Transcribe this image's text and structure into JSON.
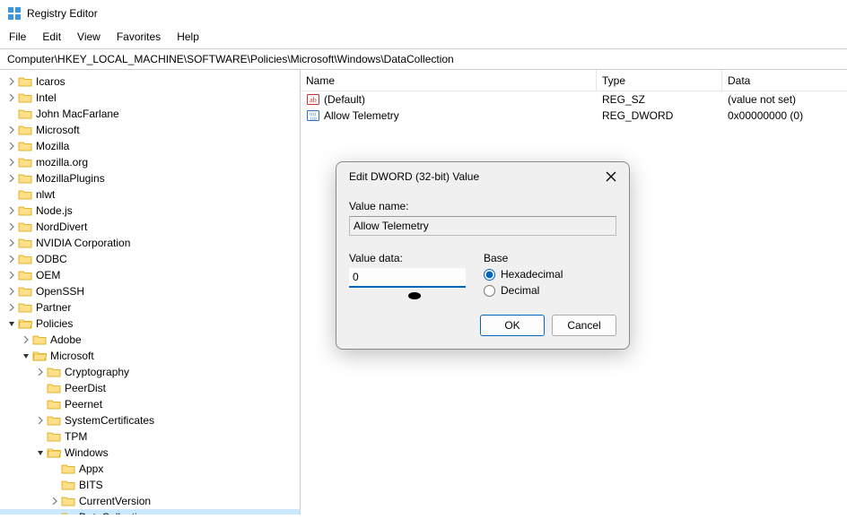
{
  "title": "Registry Editor",
  "menu": {
    "file": "File",
    "edit": "Edit",
    "view": "View",
    "favorites": "Favorites",
    "help": "Help"
  },
  "address_prefix": "Computer\\",
  "address_path": "HKEY_LOCAL_MACHINE\\SOFTWARE\\Policies\\Microsoft\\Windows\\DataCollection",
  "columns": {
    "name": "Name",
    "type": "Type",
    "data": "Data"
  },
  "values": [
    {
      "icon": "string",
      "name": "(Default)",
      "type": "REG_SZ",
      "data": "(value not set)"
    },
    {
      "icon": "binary",
      "name": "Allow Telemetry",
      "type": "REG_DWORD",
      "data": "0x00000000 (0)"
    }
  ],
  "tree": [
    {
      "indent": 1,
      "chev": "r",
      "open": false,
      "label": "Icaros"
    },
    {
      "indent": 1,
      "chev": "r",
      "open": false,
      "label": "Intel"
    },
    {
      "indent": 1,
      "chev": " ",
      "open": false,
      "label": "John MacFarlane"
    },
    {
      "indent": 1,
      "chev": "r",
      "open": false,
      "label": "Microsoft"
    },
    {
      "indent": 1,
      "chev": "r",
      "open": false,
      "label": "Mozilla"
    },
    {
      "indent": 1,
      "chev": "r",
      "open": false,
      "label": "mozilla.org"
    },
    {
      "indent": 1,
      "chev": "r",
      "open": false,
      "label": "MozillaPlugins"
    },
    {
      "indent": 1,
      "chev": " ",
      "open": false,
      "label": "nlwt"
    },
    {
      "indent": 1,
      "chev": "r",
      "open": false,
      "label": "Node.js"
    },
    {
      "indent": 1,
      "chev": "r",
      "open": false,
      "label": "NordDivert"
    },
    {
      "indent": 1,
      "chev": "r",
      "open": false,
      "label": "NVIDIA Corporation"
    },
    {
      "indent": 1,
      "chev": "r",
      "open": false,
      "label": "ODBC"
    },
    {
      "indent": 1,
      "chev": "r",
      "open": false,
      "label": "OEM"
    },
    {
      "indent": 1,
      "chev": "r",
      "open": false,
      "label": "OpenSSH"
    },
    {
      "indent": 1,
      "chev": "r",
      "open": false,
      "label": "Partner"
    },
    {
      "indent": 1,
      "chev": "d",
      "open": true,
      "label": "Policies"
    },
    {
      "indent": 2,
      "chev": "r",
      "open": false,
      "label": "Adobe"
    },
    {
      "indent": 2,
      "chev": "d",
      "open": true,
      "label": "Microsoft"
    },
    {
      "indent": 3,
      "chev": "r",
      "open": false,
      "label": "Cryptography"
    },
    {
      "indent": 3,
      "chev": " ",
      "open": false,
      "label": "PeerDist"
    },
    {
      "indent": 3,
      "chev": " ",
      "open": false,
      "label": "Peernet"
    },
    {
      "indent": 3,
      "chev": "r",
      "open": false,
      "label": "SystemCertificates"
    },
    {
      "indent": 3,
      "chev": " ",
      "open": false,
      "label": "TPM"
    },
    {
      "indent": 3,
      "chev": "d",
      "open": true,
      "label": "Windows"
    },
    {
      "indent": 4,
      "chev": " ",
      "open": false,
      "label": "Appx"
    },
    {
      "indent": 4,
      "chev": " ",
      "open": false,
      "label": "BITS"
    },
    {
      "indent": 4,
      "chev": "r",
      "open": false,
      "label": "CurrentVersion"
    },
    {
      "indent": 4,
      "chev": " ",
      "open": true,
      "label": "DataCollection",
      "selected": true
    }
  ],
  "dialog": {
    "title": "Edit DWORD (32-bit) Value",
    "value_name_label": "Value name:",
    "value_name": "Allow Telemetry",
    "value_data_label": "Value data:",
    "value_data": "0",
    "base_label": "Base",
    "hex_label": "Hexadecimal",
    "dec_label": "Decimal",
    "base": "hex",
    "ok": "OK",
    "cancel": "Cancel"
  }
}
